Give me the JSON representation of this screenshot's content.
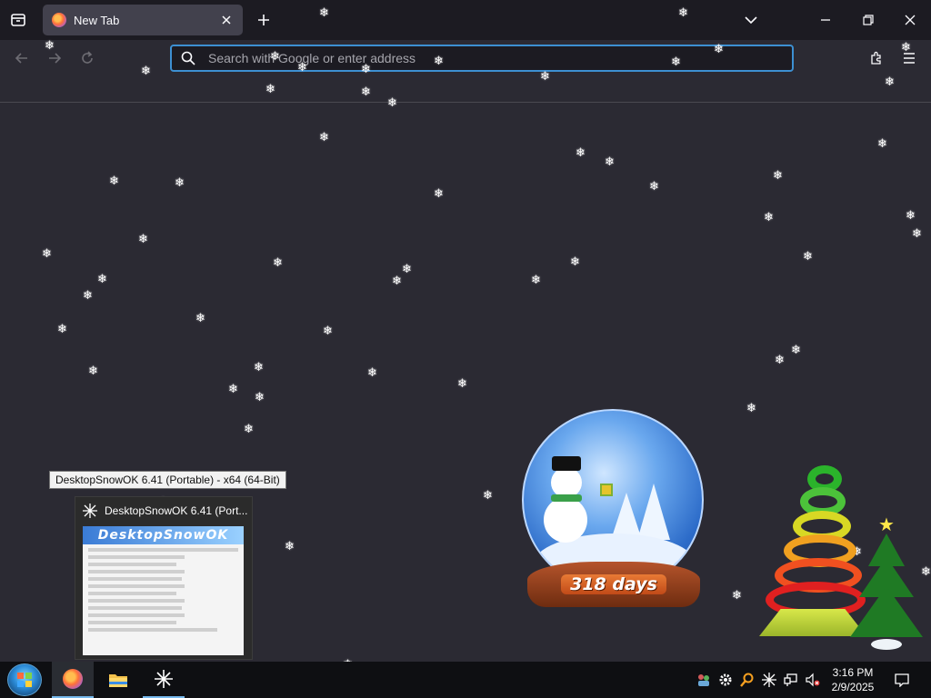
{
  "browser": {
    "tab": {
      "title": "New Tab",
      "favicon": "firefox-icon"
    },
    "urlbar": {
      "placeholder": "Search with Google or enter address"
    },
    "icons": {
      "tab_list": "tab-list-icon",
      "close_tab": "close-icon",
      "new_tab": "plus-icon",
      "back": "back-arrow-icon",
      "forward": "forward-arrow-icon",
      "reload": "reload-icon",
      "search": "search-icon",
      "extensions": "puzzle-icon",
      "menu": "hamburger-icon"
    },
    "window_controls": [
      "chevron-down-icon",
      "minimize-icon",
      "restore-icon",
      "close-icon"
    ]
  },
  "snow_globe": {
    "counter": "318 days"
  },
  "taskbar_tooltip": {
    "text": "DesktopSnowOK 6.41 (Portable) - x64 (64-Bit)"
  },
  "thumbnail": {
    "title": "DesktopSnowOK 6.41 (Port...",
    "app_banner": "DesktopSnowOK"
  },
  "taskbar": {
    "items": [
      {
        "name": "start-button",
        "icon": "windows-orb-icon"
      },
      {
        "name": "firefox",
        "icon": "firefox-icon",
        "state": "active"
      },
      {
        "name": "file-explorer",
        "icon": "folder-icon",
        "state": "normal"
      },
      {
        "name": "desktopsnowok",
        "icon": "snowflake-icon",
        "state": "open"
      }
    ],
    "tray": [
      "people-icon",
      "gear-icon",
      "search-tool-icon",
      "snowflake-icon",
      "network-icon",
      "volume-muted-icon"
    ],
    "clock": {
      "time": "3:16 PM",
      "date": "2/9/2025"
    },
    "notifications_icon": "notification-icon"
  },
  "colors": {
    "page_bg": "#2b2a33",
    "tabbar_bg": "#1c1b22",
    "urlbar_border": "#3d90d2",
    "taskbar_bg": "#0e0f12"
  }
}
